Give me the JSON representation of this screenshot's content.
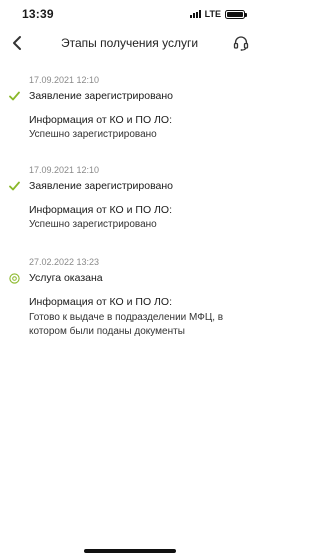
{
  "status_bar": {
    "time": "13:39",
    "network": "LTE",
    "battery_level": 1.0
  },
  "nav": {
    "title": "Этапы получения услуги",
    "back_icon": "chevron-left-icon",
    "support_icon": "headset-icon"
  },
  "stages": [
    {
      "date": "17.09.2021 12:10",
      "status": "completed",
      "icon": "check-icon",
      "title": "Заявление зарегистрировано",
      "info_label": "Информация от КО и ПО ЛО:",
      "info_text": "Успешно зарегистрировано"
    },
    {
      "date": "17.09.2021 12:10",
      "status": "completed",
      "icon": "check-icon",
      "title": "Заявление зарегистрировано",
      "info_label": "Информация от КО и ПО ЛО:",
      "info_text": "Успешно зарегистрировано"
    },
    {
      "date": "27.02.2022 13:23",
      "status": "ready",
      "icon": "circle-icon",
      "title": "Услуга оказана",
      "info_label": "Информация от КО и ПО ЛО:",
      "info_text": "Готово к выдаче в подразделении МФЦ, в котором были поданы документы"
    }
  ],
  "colors": {
    "accent": "#8ab82a",
    "date": "#8a8a8a"
  }
}
